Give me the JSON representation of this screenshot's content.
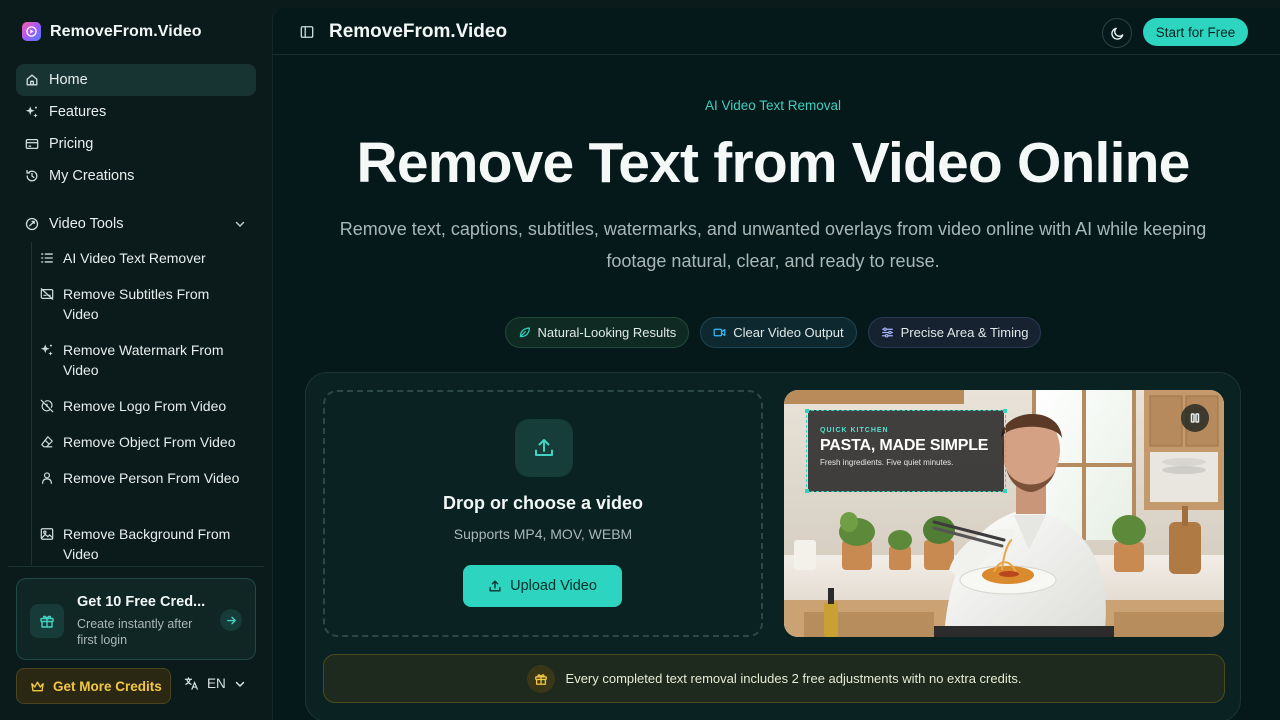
{
  "app": {
    "brand_name": "RemoveFrom.Video"
  },
  "sidebar": {
    "nav": [
      {
        "label": "Home",
        "icon": "home-icon",
        "active": true
      },
      {
        "label": "Features",
        "icon": "sparkles-icon",
        "active": false
      },
      {
        "label": "Pricing",
        "icon": "credit-card-icon",
        "active": false
      },
      {
        "label": "My Creations",
        "icon": "history-icon",
        "active": false
      }
    ],
    "section_label": "Video Tools",
    "tools": [
      {
        "label": "AI Video Text Remover",
        "icon": "list-icon"
      },
      {
        "label": "Remove Subtitles From Video",
        "icon": "captions-off-icon"
      },
      {
        "label": "Remove Watermark From Video",
        "icon": "sparkles-icon"
      },
      {
        "label": "Remove Logo From Video",
        "icon": "logo-off-icon"
      },
      {
        "label": "Remove Object From Video",
        "icon": "eraser-icon"
      },
      {
        "label": "Remove Person From Video",
        "icon": "person-icon"
      },
      {
        "label": "Remove Background From Video",
        "icon": "image-icon"
      }
    ],
    "credit_card": {
      "title": "Get 10 Free Cred...",
      "subtitle": "Create instantly after first login"
    },
    "get_credits_label": "Get More Credits",
    "language": "EN"
  },
  "topbar": {
    "title": "RemoveFrom.Video",
    "start_label": "Start for Free"
  },
  "hero": {
    "eyebrow": "AI Video Text Removal",
    "title": "Remove Text from Video Online",
    "subtitle": "Remove text, captions, subtitles, watermarks, and unwanted overlays from video online with AI while keeping footage natural, clear, and ready to reuse."
  },
  "chips": [
    {
      "label": "Natural-Looking Results",
      "icon": "leaf-icon",
      "color": "#2dd4bf"
    },
    {
      "label": "Clear Video Output",
      "icon": "video-icon",
      "color": "#38bdf8"
    },
    {
      "label": "Precise Area & Timing",
      "icon": "sliders-icon",
      "color": "#a5b4fc"
    }
  ],
  "upload": {
    "title": "Drop or choose a video",
    "formats": "Supports MP4, MOV, WEBM",
    "button_label": "Upload Video"
  },
  "preview": {
    "overlay_kicker": "QUICK KITCHEN",
    "overlay_title": "PASTA, MADE SIMPLE",
    "overlay_note": "Fresh ingredients. Five quiet minutes."
  },
  "notice": {
    "text": "Every completed text removal includes 2 free adjustments with no extra credits."
  },
  "colors": {
    "accent": "#2dd4bf",
    "background": "#06191a",
    "gold": "#f2c744"
  }
}
